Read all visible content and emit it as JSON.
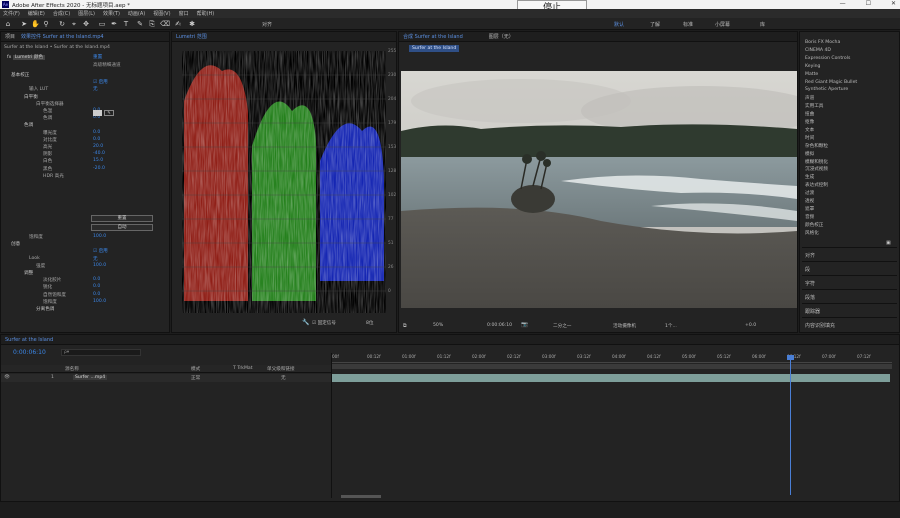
{
  "window": {
    "title": "Adobe After Effects 2020 - 无标题项目.aep *",
    "logo": "Ae",
    "min": "—",
    "max": "☐",
    "close": "✕"
  },
  "menu": [
    "文件(F)",
    "编辑(E)",
    "合成(C)",
    "图层(L)",
    "效果(T)",
    "动画(A)",
    "视图(V)",
    "窗口",
    "帮助(H)"
  ],
  "popup": "停止",
  "toolbar": {
    "snap_label": "对齐",
    "workspaces": [
      "默认",
      "了解",
      "标准",
      "小屏幕",
      "库"
    ]
  },
  "effects": {
    "tab1": "项目",
    "tab2": "效果控件 Surfer at the Island.mp4",
    "breadcrumb": "Surfer at the Island • Surfer at the Island.mp4",
    "reset": "重置",
    "fx_name": "Lumetri 颜色",
    "bypass_label": "高级精细通道",
    "rows": [
      {
        "t": "基本校正",
        "k": "sect",
        "x": 10
      },
      {
        "t": "",
        "v": "☑ 启用",
        "x": 93
      },
      {
        "t": "输入 LUT",
        "v": "无",
        "x": 28
      },
      {
        "t": "白平衡",
        "k": "sect",
        "x": 23
      },
      {
        "t": "白平衡选择器",
        "x": 35
      },
      {
        "t": "色温",
        "v": "0.0",
        "x": 42
      },
      {
        "t": "色调",
        "v": "0.0",
        "x": 42
      },
      {
        "t": "色调",
        "k": "sect",
        "x": 23
      },
      {
        "t": "曝光度",
        "v": "0.0",
        "x": 42
      },
      {
        "t": "对比度",
        "v": "0.0",
        "x": 42
      },
      {
        "t": "高光",
        "v": "20.0",
        "x": 42
      },
      {
        "t": "阴影",
        "v": "-40.0",
        "x": 42
      },
      {
        "t": "白色",
        "v": "15.0",
        "x": 42
      },
      {
        "t": "黑色",
        "v": "-20.0",
        "x": 42
      },
      {
        "t": "HDR 高光",
        "v": "",
        "x": 42
      }
    ],
    "btn_reset": "重置",
    "btn_auto": "自动",
    "rows2": [
      {
        "t": "饱和度",
        "v": "100.0",
        "x": 28
      },
      {
        "t": "创意",
        "k": "sect",
        "x": 10
      },
      {
        "t": "",
        "v": "☑ 启用",
        "x": 93
      },
      {
        "t": "Look",
        "v": "无",
        "x": 28
      },
      {
        "t": "强度",
        "v": "100.0",
        "x": 35
      },
      {
        "t": "调整",
        "k": "sect",
        "x": 23
      },
      {
        "t": "淡化胶片",
        "v": "0.0",
        "x": 42
      },
      {
        "t": "锐化",
        "v": "0.0",
        "x": 42
      },
      {
        "t": "自然饱和度",
        "v": "0.0",
        "x": 42
      },
      {
        "t": "饱和度",
        "v": "100.0",
        "x": 42
      },
      {
        "t": "分离色调",
        "k": "sect",
        "x": 35
      }
    ]
  },
  "scope": {
    "tab": "Lumetri 范围",
    "labels": [
      "255",
      "230",
      "204",
      "179",
      "153",
      "128",
      "102",
      "77",
      "51",
      "26",
      "0"
    ],
    "option": "8位",
    "clamp_label": "☑ 固定信号"
  },
  "comp": {
    "tab": "合成 Surfer at the Island",
    "layer_tab": "图层（无）",
    "chip": "Surfer at the Island",
    "zoom": "50%",
    "time": "0:00:06:10",
    "res": "二分之一",
    "camera": "活动摄像机",
    "views": "1个...",
    "exposure": "+0.0"
  },
  "rightpanel": {
    "effects": [
      "Boris FX Mocha",
      "CINEMA 4D",
      "Expression Controls",
      "Keying",
      "Matte",
      "Red Giant Magic Bullet",
      "Synthetic Aperture",
      "声道",
      "实用工具",
      "扭曲",
      "抠像",
      "文本",
      "时间",
      "杂色和颗粒",
      "模拟",
      "模糊和锐化",
      "沉浸式视频",
      "生成",
      "表达式控制",
      "过渡",
      "透视",
      "遮罩",
      "音频",
      "颜色校正",
      "风格化"
    ],
    "sections": [
      "对齐",
      "段",
      "字符",
      "段落",
      "跟踪器",
      "内容识别填充"
    ]
  },
  "timeline": {
    "tab": "Surfer at the Island",
    "timecode": "0:00:06:10",
    "search_placeholder": "ρ▾",
    "cols": [
      "源名称",
      "单父级和链接",
      "模式",
      "T TrkMat"
    ],
    "layer_num": "1",
    "layer_name": "Surfer ...mp4",
    "mode": "正常",
    "parent": "无",
    "ticks": [
      "00f",
      "00:12f",
      "01:00f",
      "01:12f",
      "02:00f",
      "02:12f",
      "03:00f",
      "03:12f",
      "04:00f",
      "04:12f",
      "05:00f",
      "05:12f",
      "06:00f",
      "06:12f",
      "07:00f",
      "07:12f"
    ]
  }
}
